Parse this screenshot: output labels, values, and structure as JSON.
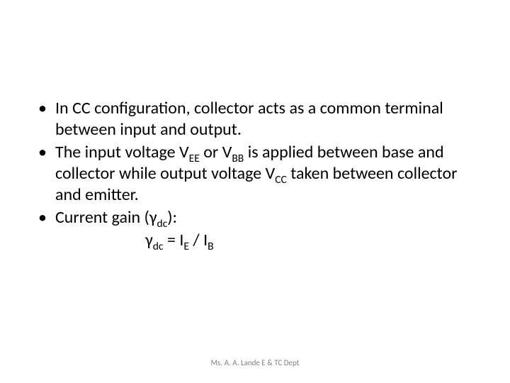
{
  "bullets": {
    "b1": {
      "t1": "In CC configuration, collector acts as a common terminal between input and output."
    },
    "b2": {
      "t1": "The input voltage V",
      "s1": "EE",
      "t2": " or V",
      "s2": "BB",
      "t3": " is applied between base and collector while output voltage V",
      "s3": "CC",
      "t4": " taken between collector and emitter."
    },
    "b3": {
      "t1": "Current gain (γ",
      "s1": "dc",
      "t2": "):"
    }
  },
  "formula": {
    "t1": "γ",
    "s1": "dc",
    "t2": " = I",
    "s2": "E",
    "t3": " / I",
    "s3": "B"
  },
  "footer": "Ms. A. A. Lande E & TC Dept"
}
